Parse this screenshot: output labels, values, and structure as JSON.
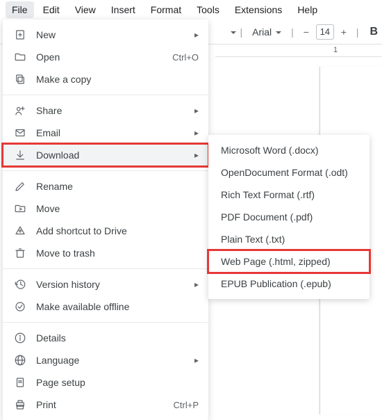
{
  "menubar": {
    "items": [
      "File",
      "Edit",
      "View",
      "Insert",
      "Format",
      "Tools",
      "Extensions",
      "Help"
    ]
  },
  "toolbar": {
    "font_name": "Arial",
    "font_size": "14",
    "bold_label": "B"
  },
  "ruler": {
    "mark1": "1"
  },
  "file_menu": {
    "new": "New",
    "open": "Open",
    "open_shortcut": "Ctrl+O",
    "make_a_copy": "Make a copy",
    "share": "Share",
    "email": "Email",
    "download": "Download",
    "rename": "Rename",
    "move": "Move",
    "add_shortcut": "Add shortcut to Drive",
    "move_to_trash": "Move to trash",
    "version_history": "Version history",
    "make_offline": "Make available offline",
    "details": "Details",
    "language": "Language",
    "page_setup": "Page setup",
    "print": "Print",
    "print_shortcut": "Ctrl+P"
  },
  "download_menu": {
    "items": [
      "Microsoft Word (.docx)",
      "OpenDocument Format (.odt)",
      "Rich Text Format (.rtf)",
      "PDF Document (.pdf)",
      "Plain Text (.txt)",
      "Web Page (.html, zipped)",
      "EPUB Publication (.epub)"
    ]
  }
}
